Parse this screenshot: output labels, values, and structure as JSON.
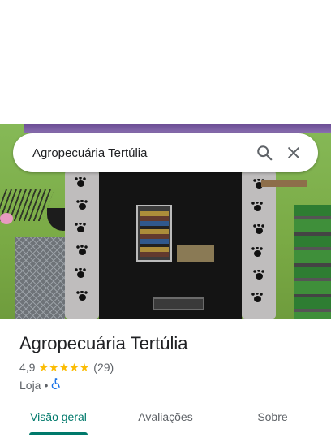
{
  "search": {
    "query": "Agropecuária Tertúlia"
  },
  "place": {
    "name": "Agropecuária Tertúlia",
    "rating": "4,9",
    "star_count": 5,
    "reviews": "(29)",
    "category": "Loja",
    "separator": "•",
    "wheelchair_icon": "accessible-icon"
  },
  "tabs": [
    {
      "label": "Visão geral",
      "active": true
    },
    {
      "label": "Avaliações",
      "active": false
    },
    {
      "label": "Sobre",
      "active": false
    }
  ],
  "colors": {
    "accent": "#00796b",
    "star": "#fbbc04",
    "accessibility_icon": "#1a73e8"
  },
  "icons": {
    "search": "search-icon",
    "close": "close-icon"
  }
}
